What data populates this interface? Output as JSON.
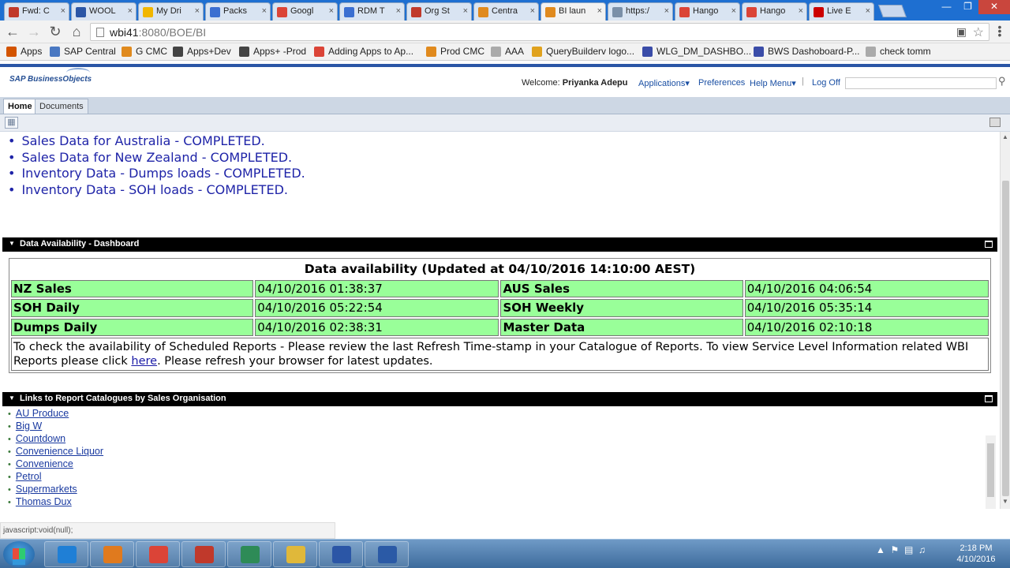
{
  "browser": {
    "tabs": [
      {
        "title": "Fwd: C",
        "favicon": "gmail-icon",
        "color": "#c0392b"
      },
      {
        "title": "WOOL",
        "favicon": "doc-icon",
        "color": "#2b56a6"
      },
      {
        "title": "My Dri",
        "favicon": "drive-icon",
        "color": "#f1b600"
      },
      {
        "title": "Packs",
        "favicon": "docs-icon",
        "color": "#3b6fd1"
      },
      {
        "title": "Googl",
        "favicon": "google-icon",
        "color": "#db4437"
      },
      {
        "title": "RDM T",
        "favicon": "sheet-icon",
        "color": "#3b6fd1"
      },
      {
        "title": "Org St",
        "favicon": "gmail-icon",
        "color": "#c0392b"
      },
      {
        "title": "Centra",
        "favicon": "sap-icon",
        "color": "#e08a1e"
      },
      {
        "title": "BI laun",
        "favicon": "sap-icon",
        "color": "#e08a1e",
        "active": true
      },
      {
        "title": "https:/",
        "favicon": "loading-icon",
        "color": "#7a8fa8"
      },
      {
        "title": "Hango",
        "favicon": "google-icon",
        "color": "#db4437"
      },
      {
        "title": "Hango",
        "favicon": "google-icon",
        "color": "#db4437"
      },
      {
        "title": "Live E",
        "favicon": "youtube-icon",
        "color": "#cc0000"
      }
    ],
    "url_host": "wbi41",
    "url_path": ":8080/BOE/BI",
    "bookmarks": [
      {
        "label": "Apps",
        "icon": "apps-grid-icon",
        "color": "#d35400"
      },
      {
        "label": "SAP Central",
        "icon": "page-icon",
        "color": "#4a78c2"
      },
      {
        "label": "G CMC",
        "icon": "sap-icon",
        "color": "#e08a1e"
      },
      {
        "label": "Apps+Dev",
        "icon": "app-icon",
        "color": "#444"
      },
      {
        "label": "Apps+ -Prod",
        "icon": "app-icon",
        "color": "#444"
      },
      {
        "label": "Adding Apps to Ap...",
        "icon": "chrome-icon",
        "color": "#db4437"
      },
      {
        "label": "Prod CMC",
        "icon": "sap-icon",
        "color": "#e08a1e"
      },
      {
        "label": "AAA",
        "icon": "page-icon",
        "color": "#aaa"
      },
      {
        "label": "QueryBuilderv logo...",
        "icon": "scn-icon",
        "color": "#e0a21e"
      },
      {
        "label": "WLG_DM_DASHBO...",
        "icon": "sap-icon",
        "color": "#3a4ca8"
      },
      {
        "label": "BWS Dashoboard-P...",
        "icon": "sap-icon",
        "color": "#3a4ca8"
      },
      {
        "label": "check tomm",
        "icon": "page-icon",
        "color": "#aaa"
      }
    ],
    "status_url": "javascript:void(null);"
  },
  "bi": {
    "logo_text": "SAP BusinessObjects",
    "welcome_prefix": "Welcome:",
    "user_name": "Priyanka Adepu",
    "applications": "Applications",
    "preferences": "Preferences",
    "help_menu": "Help Menu",
    "log_off": "Log Off",
    "tabs": [
      "Home",
      "Documents"
    ]
  },
  "status_messages": [
    "Sales Data for Australia - COMPLETED.",
    "Sales Data for New Zealand - COMPLETED.",
    "Inventory Data - Dumps loads - COMPLETED.",
    "Inventory Data - SOH loads - COMPLETED."
  ],
  "dashboard_panel": {
    "title": "Data Availability - Dashboard",
    "table_title": "Data availability (Updated at 04/10/2016 14:10:00 AEST)",
    "rows": [
      {
        "l1": "NZ Sales",
        "v1": "04/10/2016 01:38:37",
        "l2": "AUS Sales",
        "v2": "04/10/2016 04:06:54"
      },
      {
        "l1": "SOH Daily",
        "v1": "04/10/2016 05:22:54",
        "l2": "SOH Weekly",
        "v2": "04/10/2016 05:35:14"
      },
      {
        "l1": "Dumps Daily",
        "v1": "04/10/2016 02:38:31",
        "l2": "Master Data",
        "v2": "04/10/2016 02:10:18"
      }
    ],
    "note_before": "To check the availability of Scheduled Reports - Please review the last Refresh Time-stamp in your Catalogue of Reports. To view Service Level Information related WBI Reports please click ",
    "note_link": "here",
    "note_after": ". Please refresh your browser for latest updates.",
    "highlight_color": "#99ff99"
  },
  "links_panel": {
    "title": "Links to Report Catalogues by Sales Organisation",
    "links": [
      "AU Produce",
      "Big W",
      "Countdown",
      "Convenience Liquor",
      "Convenience",
      "Petrol",
      "Supermarkets",
      "Thomas Dux"
    ]
  },
  "taskbar": {
    "apps": [
      {
        "name": "ie-icon",
        "color": "#1f7fd6"
      },
      {
        "name": "media-player-icon",
        "color": "#e07a1e"
      },
      {
        "name": "chrome-icon",
        "color": "#db4437"
      },
      {
        "name": "pdf-icon",
        "color": "#c0392b"
      },
      {
        "name": "remote-desktop-icon",
        "color": "#2e8b57"
      },
      {
        "name": "explorer-folder-icon",
        "color": "#e0b83a"
      },
      {
        "name": "network-computer-icon",
        "color": "#2b56a6"
      },
      {
        "name": "word-icon",
        "color": "#2b5aa6"
      }
    ],
    "time": "2:18 PM",
    "date": "4/10/2016"
  }
}
